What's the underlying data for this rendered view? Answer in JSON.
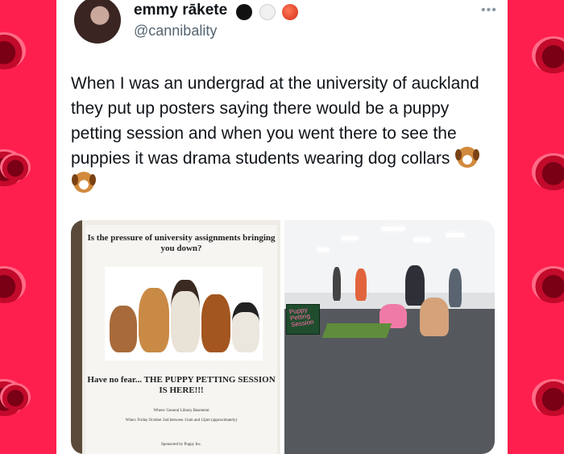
{
  "tweet": {
    "display_name": "emmy rākete",
    "handle": "@cannibality",
    "more_label": "•••",
    "text": "When I was an undergrad at the university of auckland they put up posters saying there would be a puppy petting session and when you went there to see the puppies it was drama students wearing dog collars"
  },
  "media": {
    "poster": {
      "question": "Is the pressure of university assignments bringing you down?",
      "no_fear": "Have no fear... THE PUPPY PETTING SESSION IS HERE!!!",
      "where": "Where: General Library Basement",
      "when": "When: Friday October 2nd between 11am and 12pm (approximately)",
      "sponsor": "Sponsored by Puppy Inc."
    },
    "photo": {
      "sign_text": "Puppy Petting Session"
    }
  },
  "icons": {
    "badge_1": "black-circle-icon",
    "badge_2": "white-circle-icon",
    "badge_3": "tomato-icon",
    "emoji": "dog-face-icon"
  },
  "colors": {
    "background": "#ff1f4f",
    "text": "#0f1419",
    "muted": "#536471"
  }
}
